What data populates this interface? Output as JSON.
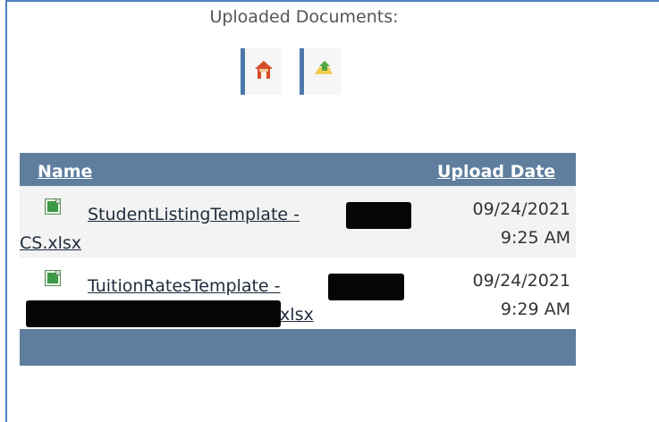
{
  "title": "Uploaded Documents:",
  "icons": {
    "home": "home-icon",
    "upload": "upload-icon",
    "file": "excel-file-icon"
  },
  "table": {
    "headers": {
      "name": "Name",
      "upload_date": "Upload Date"
    },
    "rows": [
      {
        "filename_part_1": "StudentListingTemplate -",
        "filename_part_2": "CS.xlsx",
        "date": "09/24/2021",
        "time": "9:25 AM"
      },
      {
        "filename_part_1": "TuitionRatesTemplate -",
        "filename_part_2": ".xlsx",
        "date": "09/24/2021",
        "time": "9:29 AM"
      }
    ]
  },
  "colors": {
    "header_bg": "#5f7e9e",
    "frame": "#4f7fbf",
    "nav_accent": "#4d79a8"
  }
}
